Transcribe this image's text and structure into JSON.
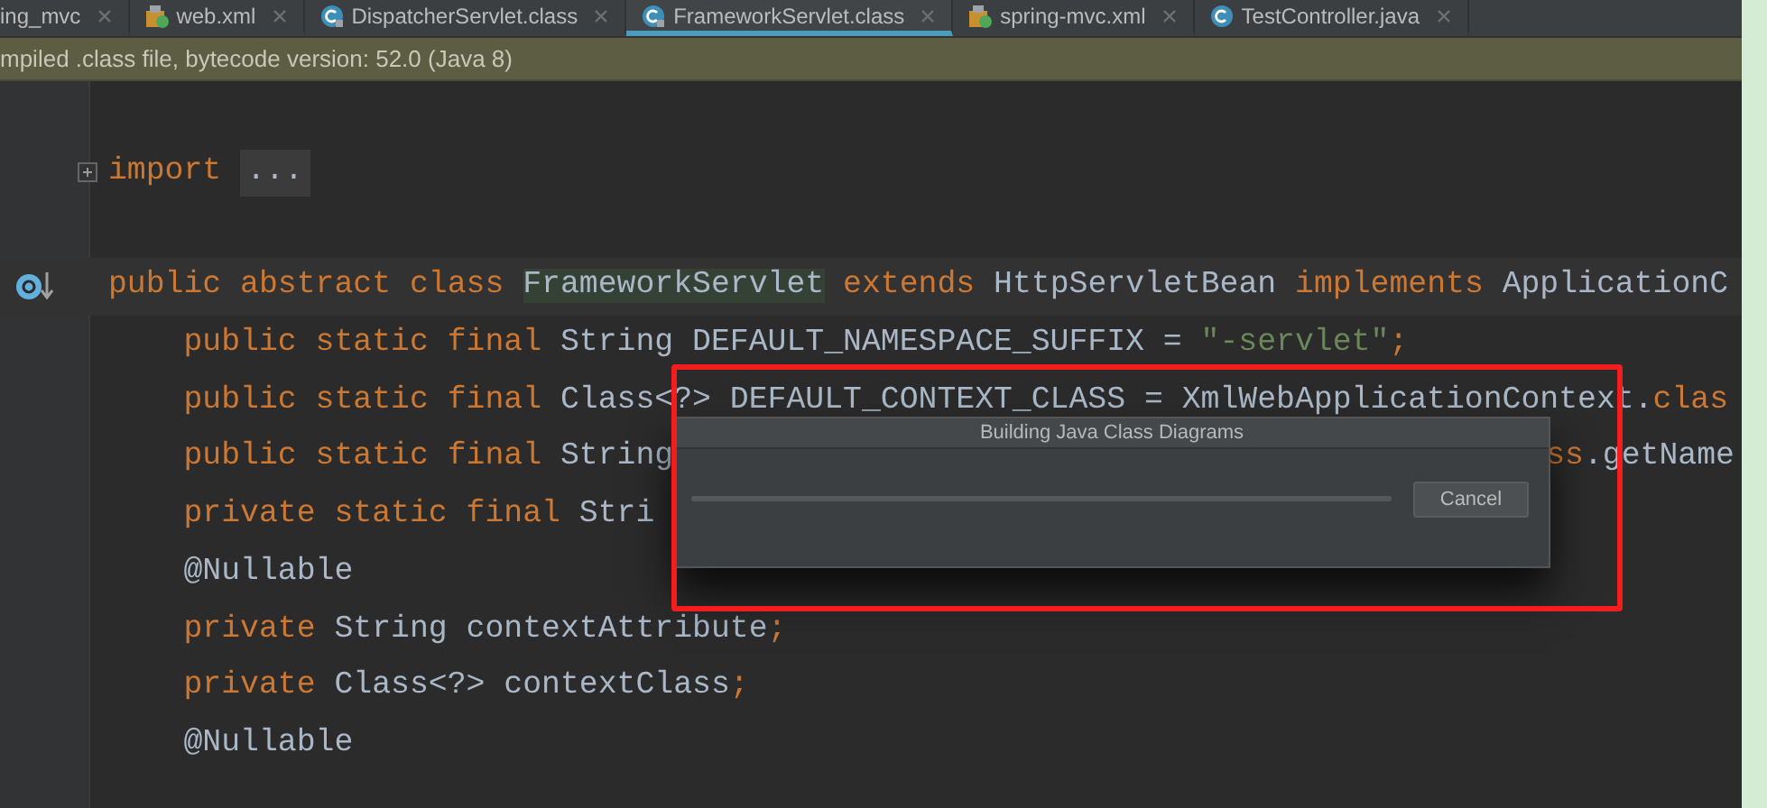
{
  "tabs": [
    {
      "label": "ing_mvc",
      "kind": "none",
      "selected": false
    },
    {
      "label": "web.xml",
      "kind": "xml",
      "selected": false
    },
    {
      "label": "DispatcherServlet.class",
      "kind": "class",
      "selected": false
    },
    {
      "label": "FrameworkServlet.class",
      "kind": "class",
      "selected": true
    },
    {
      "label": "spring-mvc.xml",
      "kind": "xml",
      "selected": false
    },
    {
      "label": "TestController.java",
      "kind": "java",
      "selected": false
    }
  ],
  "banner": {
    "text": "mpiled .class file, bytecode version: 52.0 (Java 8)"
  },
  "editor": {
    "lines": [
      {
        "kind": "blank"
      },
      {
        "kind": "import",
        "keyword": "import",
        "folded": "..."
      },
      {
        "kind": "blank"
      },
      {
        "kind": "code",
        "gutter_icon": true,
        "current": true,
        "segments": [
          {
            "kind": "keyword",
            "text": "public abstract class "
          },
          {
            "kind": "match",
            "text": "FrameworkServlet"
          },
          {
            "kind": "keyword",
            "text": " extends "
          },
          {
            "kind": "plain",
            "text": "HttpServletBean"
          },
          {
            "kind": "keyword",
            "text": " implements "
          },
          {
            "kind": "plain",
            "text": "ApplicationC"
          }
        ]
      },
      {
        "kind": "code",
        "segments": [
          {
            "kind": "keyword",
            "text": "    public static final "
          },
          {
            "kind": "plain",
            "text": "String DEFAULT_NAMESPACE_SUFFIX = "
          },
          {
            "kind": "string",
            "text": "\"-servlet\""
          },
          {
            "kind": "keyword",
            "text": ";"
          }
        ]
      },
      {
        "kind": "code",
        "segments": [
          {
            "kind": "keyword",
            "text": "    public static final "
          },
          {
            "kind": "plain",
            "text": "Class<?> DEFAULT_CONTEXT_CLASS = XmlWebApplicationContext."
          },
          {
            "kind": "keyword",
            "text": "clas"
          }
        ]
      },
      {
        "kind": "code",
        "segments": [
          {
            "kind": "keyword",
            "text": "    public static final "
          },
          {
            "kind": "plain",
            "text": "String"
          }
        ],
        "right_segments": [
          {
            "kind": "keyword",
            "text": "ss"
          },
          {
            "kind": "plain",
            "text": ".getName"
          }
        ]
      },
      {
        "kind": "code",
        "segments": [
          {
            "kind": "keyword",
            "text": "    private static final "
          },
          {
            "kind": "plain",
            "text": "Stri"
          }
        ]
      },
      {
        "kind": "code",
        "segments": [
          {
            "kind": "plain",
            "text": "    @Nullable"
          }
        ]
      },
      {
        "kind": "code",
        "segments": [
          {
            "kind": "keyword",
            "text": "    private "
          },
          {
            "kind": "plain",
            "text": "String contextAttribute"
          },
          {
            "kind": "keyword",
            "text": ";"
          }
        ]
      },
      {
        "kind": "code",
        "segments": [
          {
            "kind": "keyword",
            "text": "    private "
          },
          {
            "kind": "plain",
            "text": "Class<?> contextClass"
          },
          {
            "kind": "keyword",
            "text": ";"
          }
        ]
      },
      {
        "kind": "code",
        "segments": [
          {
            "kind": "plain",
            "text": "    @Nullable"
          }
        ]
      }
    ]
  },
  "dialog": {
    "title": "Building Java Class Diagrams",
    "progress": {
      "level": 0
    },
    "button": "Cancel"
  }
}
